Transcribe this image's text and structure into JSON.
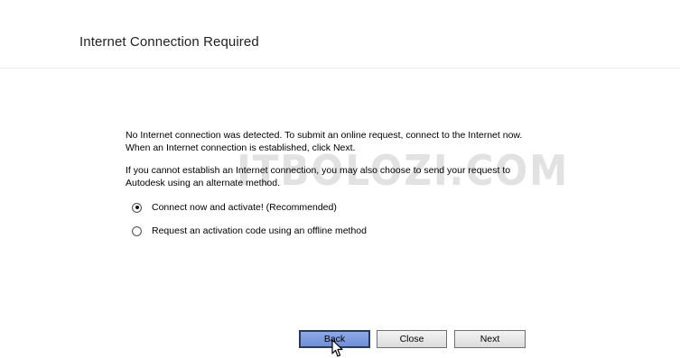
{
  "header": {
    "title": "Internet Connection Required"
  },
  "watermark": "ITBOLOZI.COM",
  "message": {
    "line1": "No Internet connection was detected. To submit an online request, connect to the Internet now.",
    "line2": "When an Internet connection is established, click Next.",
    "line3": "If you cannot establish an Internet connection, you may also choose to send your request to",
    "line4": "Autodesk using an alternate method."
  },
  "options": [
    {
      "label": "Connect now and activate! (Recommended)",
      "selected": true
    },
    {
      "label": "Request an activation code using an offline method",
      "selected": false
    }
  ],
  "buttons": {
    "back": "Back",
    "close": "Close",
    "next": "Next"
  }
}
